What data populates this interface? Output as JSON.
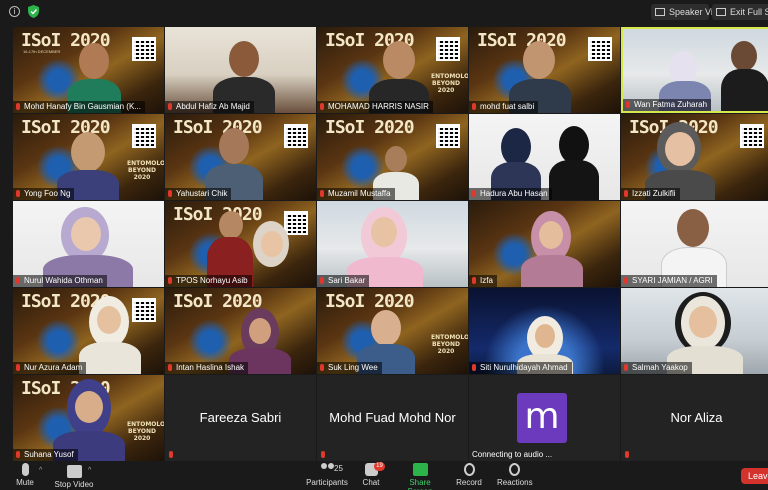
{
  "topbar": {
    "info_icon": "info-icon",
    "shield_icon": "shield-check-icon",
    "speaker_view_label": "Speaker View",
    "exit_full_screen_label": "Exit Full Screen"
  },
  "tiles": [
    {
      "name": "Mohd Hanafy Bin Gausmian (K..."
    },
    {
      "name": "Abdul Hafiz Ab Majid"
    },
    {
      "name": "MOHAMAD HARRIS NASIR"
    },
    {
      "name": "mohd fuat salbi"
    },
    {
      "name": "Wan Fatma Zuharah"
    },
    {
      "name": "Yong Foo Ng"
    },
    {
      "name": "Yahustari Chik"
    },
    {
      "name": "Muzamil Mustaffa"
    },
    {
      "name": "Hadura Abu Hasan"
    },
    {
      "name": "Izzati Zulkifli"
    },
    {
      "name": "Nurul Wahida Othman"
    },
    {
      "name": "TPOS Norhayu Asib"
    },
    {
      "name": "Sari Bakar"
    },
    {
      "name": "Izfa"
    },
    {
      "name": "SYARI JAMIAN / AGRI"
    },
    {
      "name": "Nur Azura Adam"
    },
    {
      "name": "Intan Haslina Ishak"
    },
    {
      "name": "Suk Ling Wee"
    },
    {
      "name": "Siti Nurulhidayah Ahmad"
    },
    {
      "name": "Salmah Yaakop"
    },
    {
      "name": "Suhana Yusof"
    },
    {
      "name": "Fareeza Sabri"
    },
    {
      "name": "Mohd Fuad Mohd Nor"
    },
    {
      "name": "Connecting to audio ..."
    },
    {
      "name": "Nor Aliza"
    }
  ],
  "poster": {
    "title": "ISoI 2020",
    "subtitle": "16-17th DECEMBER",
    "entomology": "ENTOMOLOGY BEYOND 2020"
  },
  "avatar_letter": "m",
  "toolbar": {
    "mute_label": "Mute",
    "stop_video_label": "Stop Video",
    "participants_label": "Participants",
    "participants_count": "25",
    "chat_label": "Chat",
    "chat_badge": "19",
    "share_screen_label": "Share Screen",
    "record_label": "Record",
    "reactions_label": "Reactions",
    "leave_label": "Leave"
  },
  "colors": {
    "share_green": "#2cb34a",
    "leave_red": "#d3332c",
    "active_speaker_border": "#d7e84c",
    "avatar_purple": "#6c3bbd"
  }
}
